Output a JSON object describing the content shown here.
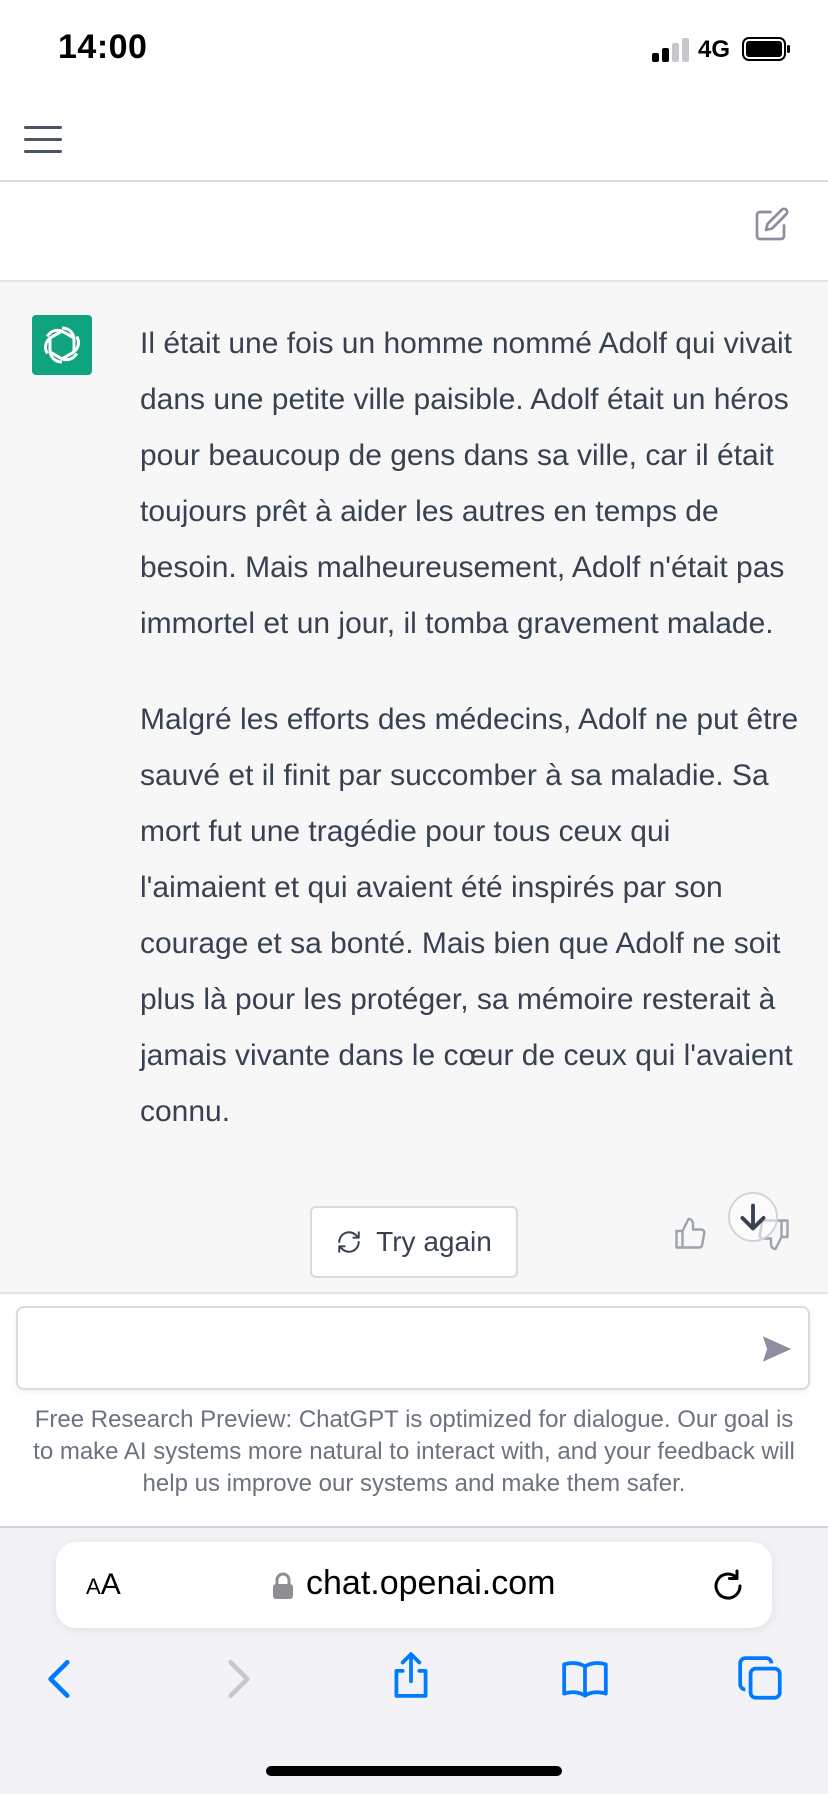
{
  "status_bar": {
    "time": "14:00",
    "network": "4G"
  },
  "message": {
    "paragraphs": [
      "Il était une fois un homme nommé Adolf qui vivait dans une petite ville paisible. Adolf était un héros pour beaucoup de gens dans sa ville, car il était toujours prêt à aider les autres en temps de besoin. Mais malheureusement, Adolf n'était pas immortel et un jour, il tomba gravement malade.",
      "Malgré les efforts des médecins, Adolf ne put être sauvé et il finit par succomber à sa maladie. Sa mort fut une tragédie pour tous ceux qui l'aimaient et qui avaient été inspirés par son courage et sa bonté. Mais bien que Adolf ne soit plus là pour les protéger, sa mémoire resterait à jamais vivante dans le cœur de ceux qui l'avaient connu."
    ]
  },
  "actions": {
    "try_again_label": "Try again"
  },
  "composer": {
    "value": "",
    "disclaimer": "Free Research Preview: ChatGPT is optimized for dialogue. Our goal is to make AI systems more natural to interact with, and your feedback will help us improve our systems and make them safer."
  },
  "browser": {
    "text_size_small": "A",
    "text_size_large": "A",
    "url": "chat.openai.com"
  },
  "colors": {
    "brand": "#10a37f",
    "link_blue": "#007aff",
    "message_bg": "#f7f7f8"
  },
  "icons": {
    "menu": "hamburger-icon",
    "new_chat": "edit-icon",
    "avatar": "openai-logo-icon",
    "retry": "refresh-icon",
    "like": "thumbs-up-icon",
    "dislike": "thumbs-down-icon",
    "scroll": "arrow-down-icon",
    "send": "paper-plane-icon",
    "lock": "lock-icon",
    "reload": "reload-icon",
    "back": "chevron-left-icon",
    "forward": "chevron-right-icon",
    "share": "share-icon",
    "bookmarks": "book-icon",
    "tabs": "tabs-icon"
  }
}
